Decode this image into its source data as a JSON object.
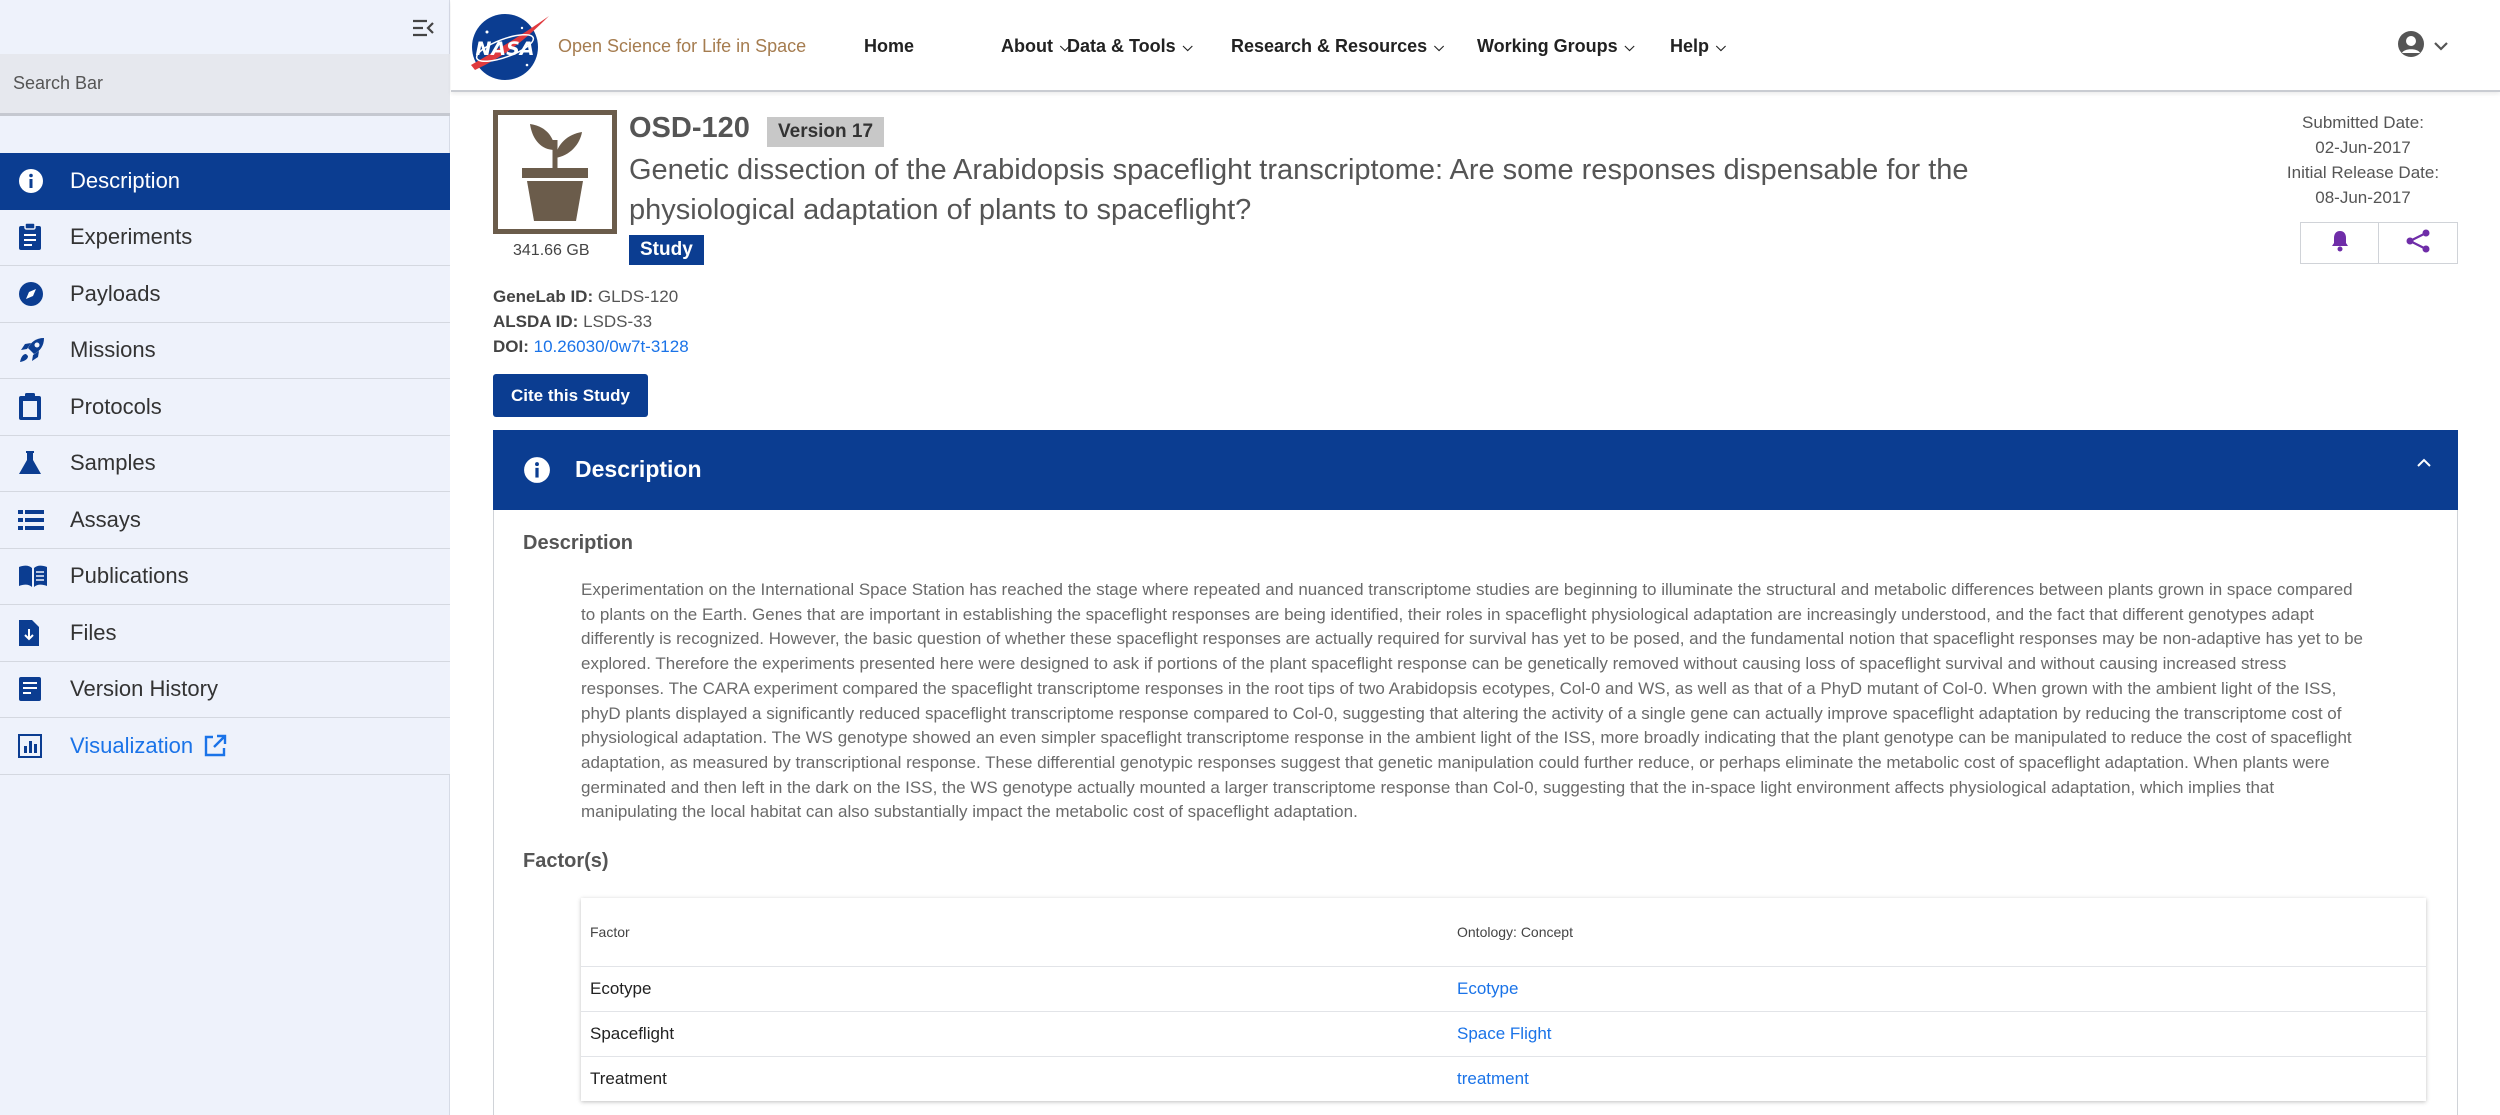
{
  "sidebar": {
    "search_placeholder": "Search Bar",
    "items": [
      {
        "label": "Description",
        "icon": "info-icon"
      },
      {
        "label": "Experiments",
        "icon": "clipboard-list-icon"
      },
      {
        "label": "Payloads",
        "icon": "compass-icon"
      },
      {
        "label": "Missions",
        "icon": "rocket-icon"
      },
      {
        "label": "Protocols",
        "icon": "clipboard-icon"
      },
      {
        "label": "Samples",
        "icon": "flask-icon"
      },
      {
        "label": "Assays",
        "icon": "list-icon"
      },
      {
        "label": "Publications",
        "icon": "book-icon"
      },
      {
        "label": "Files",
        "icon": "file-download-icon"
      },
      {
        "label": "Version History",
        "icon": "history-icon"
      },
      {
        "label": "Visualization",
        "icon": "chart-icon"
      }
    ],
    "active_index": 0
  },
  "header": {
    "brand": "Open Science for Life in Space",
    "menu": [
      {
        "label": "Home",
        "has_dropdown": false
      },
      {
        "label": "About",
        "has_dropdown": true
      },
      {
        "label": "Data & Tools",
        "has_dropdown": true
      },
      {
        "label": "Research & Resources",
        "has_dropdown": true
      },
      {
        "label": "Working Groups",
        "has_dropdown": true
      },
      {
        "label": "Help",
        "has_dropdown": true
      }
    ]
  },
  "study": {
    "id": "OSD-120",
    "version": "Version 17",
    "title": "Genetic dissection of the Arabidopsis spaceflight transcriptome: Are some responses dispensable for the physiological adaptation of plants to spaceflight?",
    "size": "341.66 GB",
    "badge": "Study",
    "genelab_label": "GeneLab ID",
    "genelab_id": "GLDS-120",
    "alsda_label": "ALSDA ID",
    "alsda_id": "LSDS-33",
    "doi_label": "DOI",
    "doi": "10.26030/0w7t-3128",
    "cite_label": "Cite this Study",
    "submitted_label": "Submitted Date:",
    "submitted_date": "02-Jun-2017",
    "release_label": "Initial Release Date:",
    "release_date": "08-Jun-2017"
  },
  "description_panel": {
    "header": "Description",
    "section_title": "Description",
    "text": "Experimentation on the International Space Station has reached the stage where repeated and nuanced transcriptome studies are beginning to illuminate the structural and metabolic differences between plants grown in space compared to plants on the Earth. Genes that are important in establishing the spaceflight responses are being identified, their roles in spaceflight physiological adaptation are increasingly understood, and the fact that different genotypes adapt differently is recognized. However, the basic question of whether these spaceflight responses are actually required for survival has yet to be posed, and the fundamental notion that spaceflight responses may be non-adaptive has yet to be explored. Therefore the experiments presented here were designed to ask if portions of the plant spaceflight response can be genetically removed without causing loss of spaceflight survival and without causing increased stress responses. The CARA experiment compared the spaceflight transcriptome responses in the root tips of two Arabidopsis ecotypes, Col-0 and WS, as well as that of a PhyD mutant of Col-0. When grown with the ambient light of the ISS, phyD plants displayed a significantly reduced spaceflight transcriptome response compared to Col-0, suggesting that altering the activity of a single gene can actually improve spaceflight adaptation by reducing the transcriptome cost of physiological adaptation. The WS genotype showed an even simpler spaceflight transcriptome response in the ambient light of the ISS, more broadly indicating that the plant genotype can be manipulated to reduce the cost of spaceflight adaptation, as measured by transcriptional response. These differential genotypic responses suggest that genetic manipulation could further reduce, or perhaps eliminate the metabolic cost of spaceflight adaptation. When plants were germinated and then left in the dark on the ISS, the WS genotype actually mounted a larger transcriptome response than Col-0, suggesting that the in-space light environment affects physiological adaptation, which implies that manipulating the local habitat can also substantially impact the metabolic cost of spaceflight adaptation.",
    "factors_title": "Factor(s)",
    "factors_columns": [
      "Factor",
      "Ontology: Concept"
    ],
    "factors": [
      {
        "factor": "Ecotype",
        "concept": "Ecotype"
      },
      {
        "factor": "Spaceflight",
        "concept": "Space Flight"
      },
      {
        "factor": "Treatment",
        "concept": "treatment"
      }
    ]
  },
  "colors": {
    "nasa_blue": "#0b3d91",
    "link_blue": "#1a73e8",
    "brand_tan": "#a57c4f",
    "share_purple": "#6f2da8"
  }
}
